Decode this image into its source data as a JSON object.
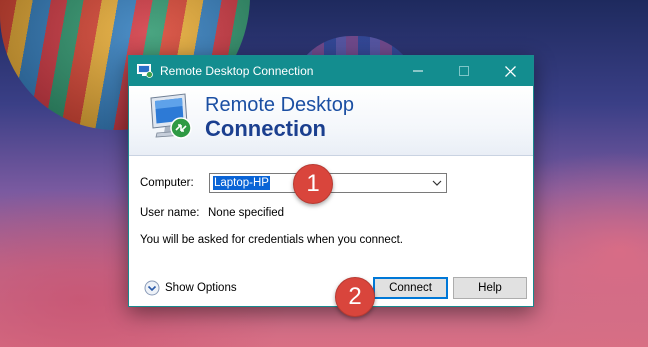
{
  "window": {
    "title": "Remote Desktop Connection",
    "accent_color": "#138d8f"
  },
  "header": {
    "line1": "Remote Desktop",
    "line2": "Connection"
  },
  "form": {
    "computer_label": "Computer:",
    "computer_value": "Laptop-HP",
    "username_label": "User name:",
    "username_value": "None specified",
    "info_text": "You will be asked for credentials when you connect."
  },
  "footer": {
    "show_options_label": "Show Options",
    "connect_label": "Connect",
    "help_label": "Help"
  },
  "annotations": {
    "marker_1": "1",
    "marker_2": "2",
    "marker_color": "#d9453c"
  }
}
